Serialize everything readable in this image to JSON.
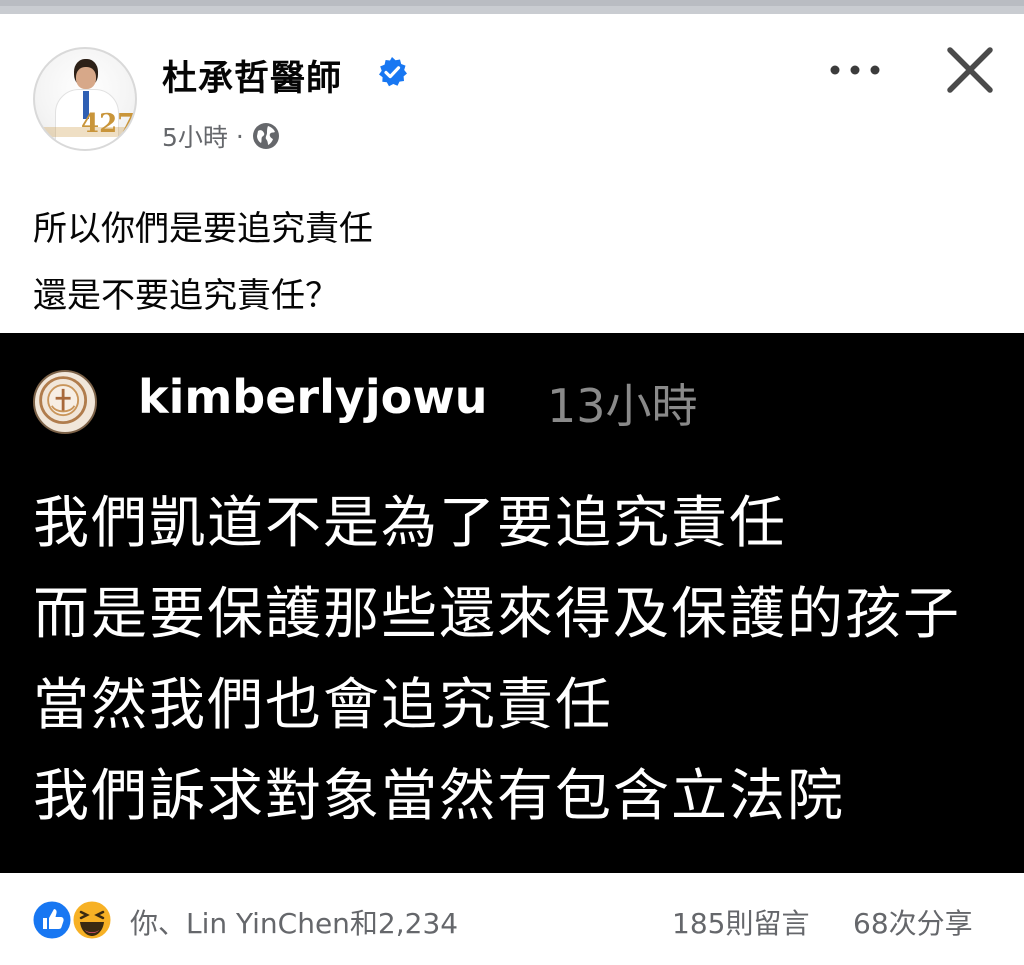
{
  "post": {
    "author": "杜承哲醫師",
    "timestamp": "5小時",
    "separator": "·",
    "caption_lines": [
      "所以你們是要追究責任",
      "還是不要追究責任？"
    ]
  },
  "header_actions": {
    "more_icon": "more-horizontal-icon",
    "close_icon": "close-icon"
  },
  "embedded_image": {
    "username": "kimberlyjowu",
    "time": "13小時",
    "lines": [
      "我們凱道不是為了要追究責任",
      "而是要保護那些還來得及保護的孩子",
      "當然我們也會追究責任",
      "我們訴求對象當然有包含立法院"
    ]
  },
  "footer": {
    "reactions_text": "你、Lin YinChen和2,234",
    "comments": "185則留言",
    "shares": "68次分享"
  },
  "colors": {
    "text_primary": "#050505",
    "text_secondary": "#65676b",
    "verified_blue": "#1877f2",
    "like_blue": "#1877f2",
    "haha_yellow": "#f7b125"
  }
}
